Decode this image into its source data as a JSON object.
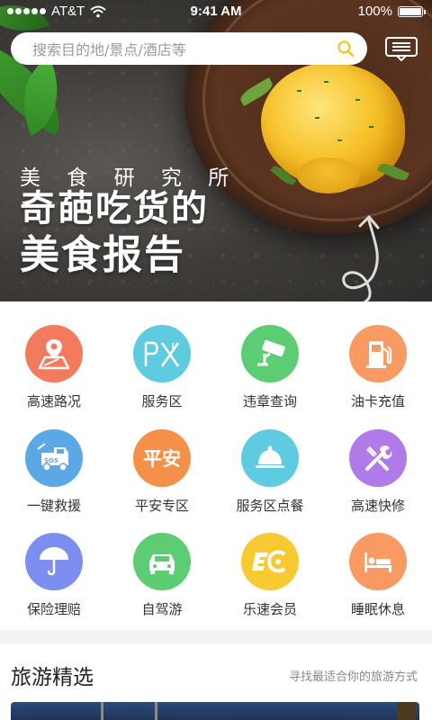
{
  "status_bar": {
    "carrier": "AT&T",
    "time": "9:41 AM",
    "battery": "100%"
  },
  "search": {
    "placeholder": "搜索目的地/景点/酒店等"
  },
  "banner": {
    "subtitle": "美 食 研 究 所",
    "title_line1": "奇葩吃货的",
    "title_line2": "美食报告"
  },
  "services": [
    {
      "label": "高速路况",
      "icon": "road-map-icon",
      "color": "#f47a5e"
    },
    {
      "label": "服务区",
      "icon": "px-service-icon",
      "color": "#5fcbe0"
    },
    {
      "label": "违章查询",
      "icon": "camera-icon",
      "color": "#5ccd72"
    },
    {
      "label": "油卡充值",
      "icon": "gas-pump-icon",
      "color": "#f99a63"
    },
    {
      "label": "一键救援",
      "icon": "tow-truck-icon",
      "color": "#5aa8e6"
    },
    {
      "label": "平安专区",
      "icon": "pingan-icon",
      "icon_text": "平安",
      "color": "#f5904a"
    },
    {
      "label": "服务区点餐",
      "icon": "food-cloche-icon",
      "color": "#5fcbe0"
    },
    {
      "label": "高速快修",
      "icon": "wrench-icon",
      "color": "#b07be8"
    },
    {
      "label": "保险理赔",
      "icon": "umbrella-icon",
      "color": "#7c8ef0"
    },
    {
      "label": "自驾游",
      "icon": "car-icon",
      "color": "#5ccd72"
    },
    {
      "label": "乐速会员",
      "icon": "member-ec-icon",
      "color": "#f9c931"
    },
    {
      "label": "睡眠休息",
      "icon": "bed-icon",
      "color": "#f99a63"
    }
  ],
  "travel": {
    "title": "旅游精选",
    "subtitle": "寻找最适合你的旅游方式"
  }
}
